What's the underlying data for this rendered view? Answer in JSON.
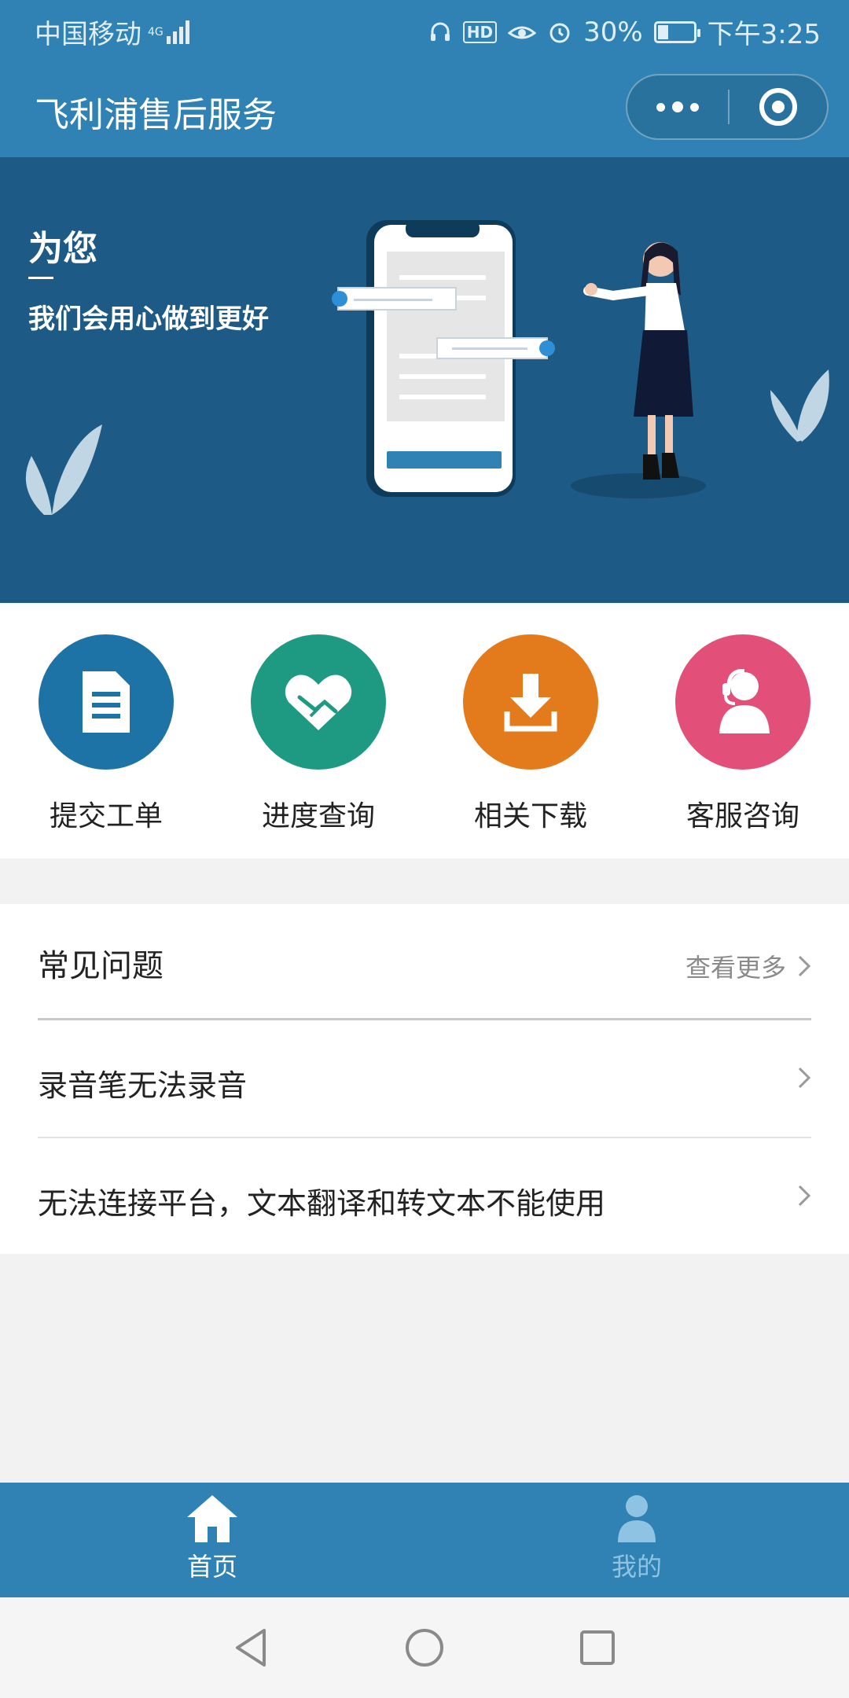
{
  "status_bar": {
    "carrier": "中国移动",
    "network": "4G",
    "hd": "HD",
    "battery": "30%",
    "battery_level": 0.3,
    "time": "下午3:25"
  },
  "navbar": {
    "title": "飞利浦售后服务"
  },
  "banner": {
    "headline": "为您",
    "subline": "我们会用心做到更好"
  },
  "quick_actions": [
    {
      "label": "提交工单",
      "color": "#1e73a6",
      "icon": "document-icon"
    },
    {
      "label": "进度查询",
      "color": "#1f9a82",
      "icon": "handshake-icon"
    },
    {
      "label": "相关下载",
      "color": "#e37a1b",
      "icon": "download-icon"
    },
    {
      "label": "客服咨询",
      "color": "#e2507a",
      "icon": "support-agent-icon"
    }
  ],
  "faq": {
    "title": "常见问题",
    "more": "查看更多",
    "items": [
      "录音笔无法录音",
      "无法连接平台，文本翻译和转文本不能使用"
    ]
  },
  "tabbar": {
    "items": [
      {
        "label": "首页",
        "icon": "home-icon",
        "active": true
      },
      {
        "label": "我的",
        "icon": "user-icon",
        "active": false
      }
    ]
  },
  "colors": {
    "primary": "#2f82b3",
    "banner": "#1d5a85"
  }
}
